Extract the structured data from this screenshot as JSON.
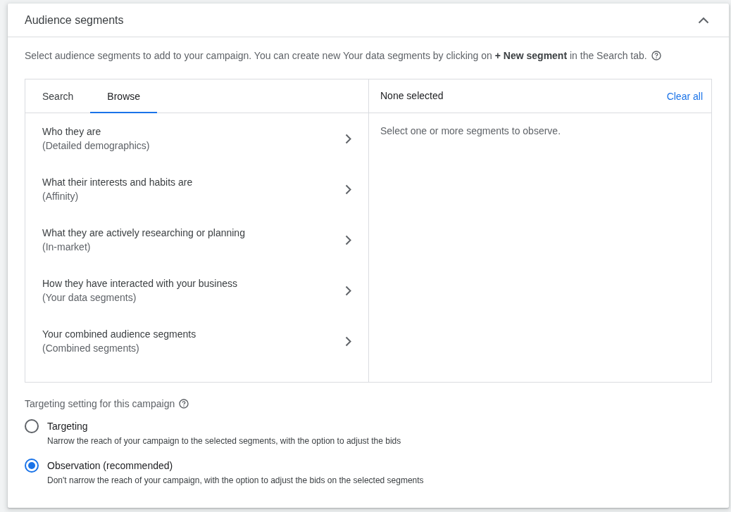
{
  "panel": {
    "title": "Audience segments",
    "expanded": true
  },
  "description": "Select audience segments to add to your campaign. You can create new Your data segments by clicking on **+ New segment** in the Search tab.",
  "browser": {
    "tabs": [
      {
        "label": "Search",
        "selected": false
      },
      {
        "label": "Browse",
        "selected": true
      }
    ],
    "categories": [
      {
        "title": "Who they are",
        "subtitle": "(Detailed demographics)"
      },
      {
        "title": "What their interests and habits are",
        "subtitle": "(Affinity)"
      },
      {
        "title": "What they are actively researching or planning",
        "subtitle": "(In-market)"
      },
      {
        "title": "How they have interacted with your business",
        "subtitle": "(Your data segments)"
      },
      {
        "title": "Your combined audience segments",
        "subtitle": "(Combined segments)"
      }
    ],
    "selection": {
      "heading": "None selected",
      "clear_label": "Clear all",
      "empty_message": "Select one or more segments to observe."
    }
  },
  "targeting": {
    "label": "Targeting setting for this campaign",
    "options": [
      {
        "label": "Targeting",
        "description": "Narrow the reach of your campaign to the selected segments, with the option to adjust the bids",
        "selected": false
      },
      {
        "label": "Observation (recommended)",
        "description": "Don't narrow the reach of your campaign, with the option to adjust the bids on the selected segments",
        "selected": true
      }
    ]
  }
}
